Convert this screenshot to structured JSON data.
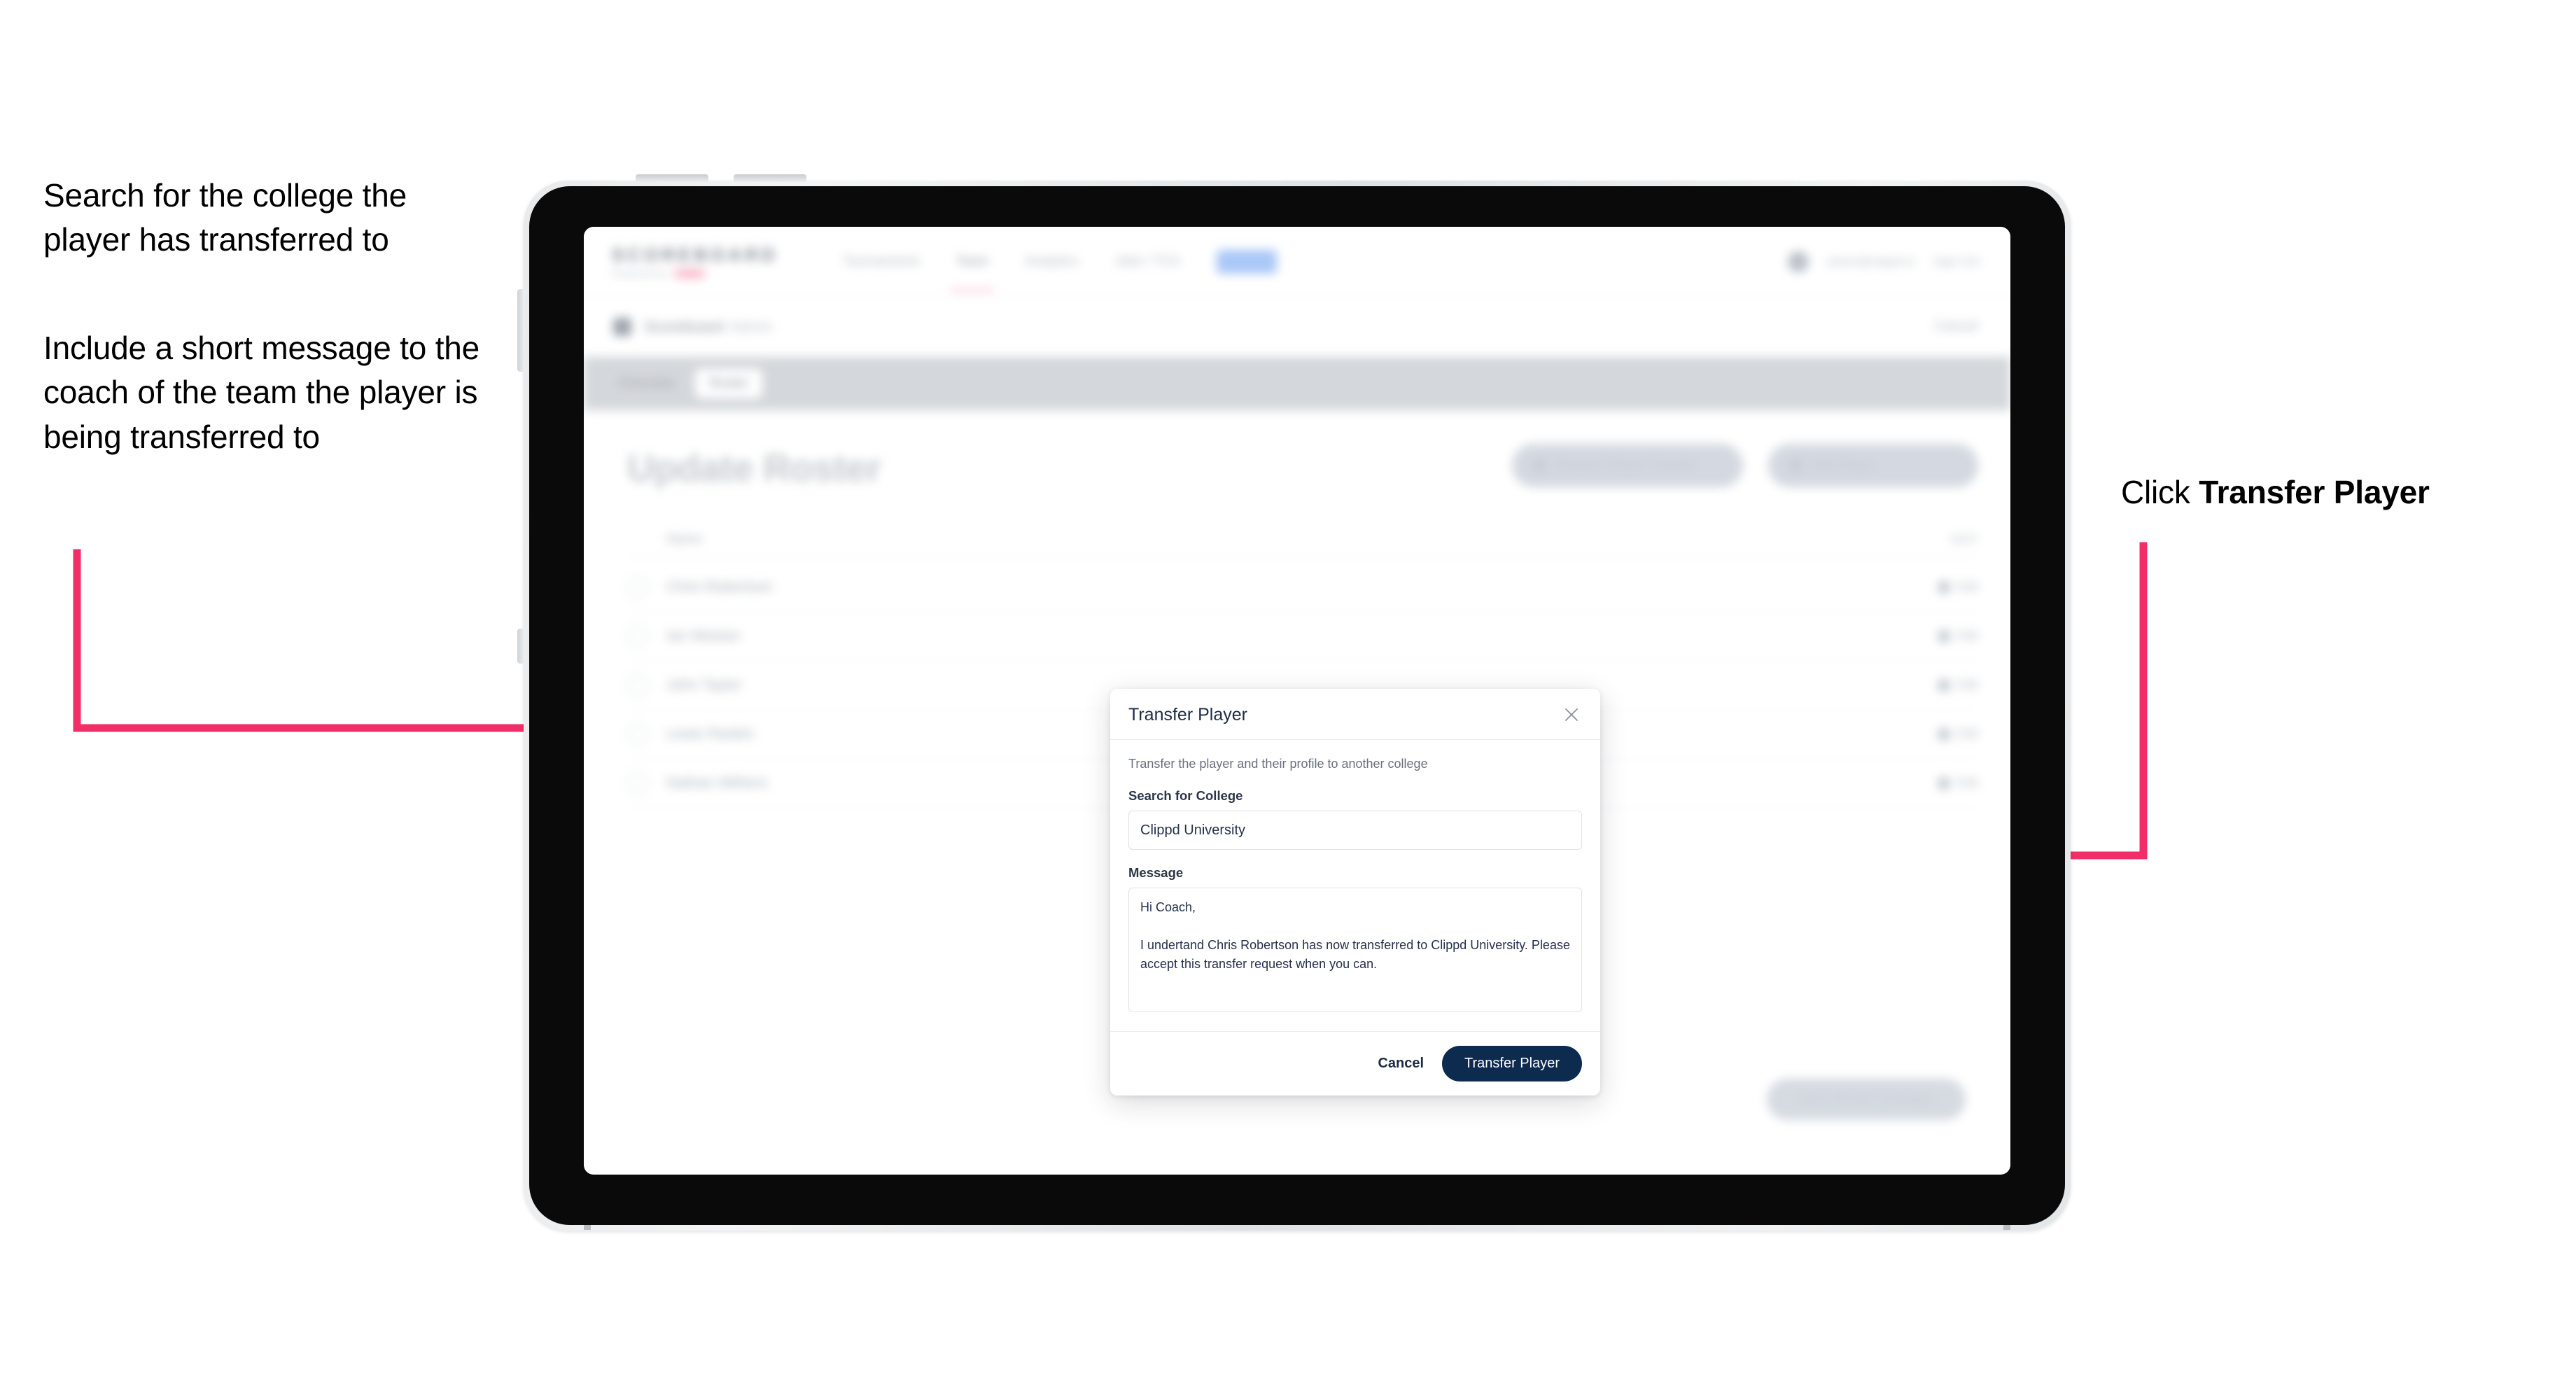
{
  "annotations": {
    "left_top": "Search for the college the player has transferred to",
    "left_bottom": "Include a short message to the coach of the team the player is being transferred to",
    "right_prefix": "Click ",
    "right_bold": "Transfer Player"
  },
  "colors": {
    "arrow_pink": "#f22e68",
    "primary_navy": "#0d2a4f",
    "tab_bar_grey": "#d3d6da"
  },
  "app": {
    "brand": {
      "name": "SCOREBOARD",
      "sub": "Powered by",
      "badge": "clippd"
    },
    "nav": [
      {
        "label": "Tournaments",
        "active": false
      },
      {
        "label": "Team",
        "active": true
      },
      {
        "label": "Analytics",
        "active": false
      },
      {
        "label": "Jobs / TCA",
        "active": false
      },
      {
        "label": "Admin",
        "pill": true
      }
    ],
    "nav_right": {
      "user": "admin@clippd.io",
      "sign_out": "Sign Out"
    },
    "subheader": {
      "title": "Scoreboard",
      "muted": "Admin",
      "right": "Cancel"
    },
    "tabs": [
      {
        "label": "Overview",
        "active": false
      },
      {
        "label": "Roster",
        "active": true
      }
    ],
    "page_title": "Update Roster",
    "header_buttons": [
      {
        "label": "Request Player Transfer"
      },
      {
        "label": "Add Player"
      }
    ],
    "roster_header": {
      "name": "Name",
      "right": "EDIT"
    },
    "roster_rows": [
      {
        "name": "Chris Robertson",
        "action": "Edit"
      },
      {
        "name": "Ian Weston",
        "action": "Edit"
      },
      {
        "name": "John Taylor",
        "action": "Edit"
      },
      {
        "name": "Lewis Rankin",
        "action": "Edit"
      },
      {
        "name": "Nathan Withers",
        "action": "Edit"
      }
    ],
    "footer_button": "Save Roster Changes"
  },
  "modal": {
    "title": "Transfer Player",
    "close_icon": "close-icon",
    "description": "Transfer the player and their profile to another college",
    "college_label": "Search for College",
    "college_value": "Clippd University",
    "college_placeholder": "Search for College",
    "message_label": "Message",
    "message_value": "Hi Coach,\n\nI undertand Chris Robertson has now transferred to Clippd University. Please accept this transfer request when you can.",
    "message_placeholder": "Message",
    "cancel_label": "Cancel",
    "submit_label": "Transfer Player"
  }
}
